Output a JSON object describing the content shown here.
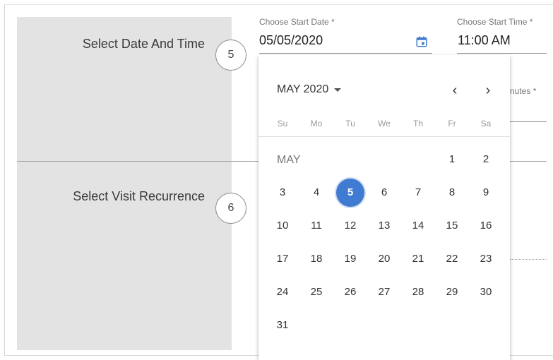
{
  "steps": [
    {
      "label": "Select Date And Time",
      "number": "5"
    },
    {
      "label": "Select Visit Recurrence",
      "number": "6"
    }
  ],
  "start_date": {
    "label": "Choose Start Date *",
    "value": "05/05/2020",
    "icon": "calendar-icon"
  },
  "start_time": {
    "label": "Choose Start Time *",
    "value": "11:00 AM"
  },
  "duration": {
    "label_fragment": "nutes *"
  },
  "calendar": {
    "header": "MAY 2020",
    "month_label": "MAY",
    "weekdays": [
      "Su",
      "Mo",
      "Tu",
      "We",
      "Th",
      "Fr",
      "Sa"
    ],
    "selected_day": "5",
    "days": [
      "1",
      "2",
      "3",
      "4",
      "5",
      "6",
      "7",
      "8",
      "9",
      "10",
      "11",
      "12",
      "13",
      "14",
      "15",
      "16",
      "17",
      "18",
      "19",
      "20",
      "21",
      "22",
      "23",
      "24",
      "25",
      "26",
      "27",
      "28",
      "29",
      "30",
      "31"
    ],
    "leading_blanks": 5,
    "accent_color": "#3f7bd1"
  }
}
